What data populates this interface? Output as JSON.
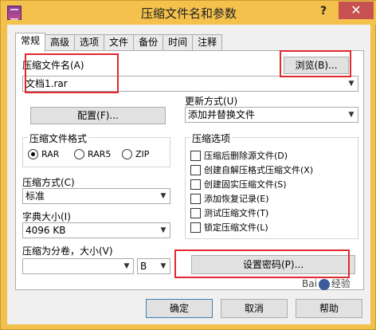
{
  "window": {
    "title": "压缩文件名和参数",
    "help": "?",
    "close": "✕"
  },
  "tabs": [
    "常规",
    "高级",
    "选项",
    "文件",
    "备份",
    "时间",
    "注释"
  ],
  "archive": {
    "label": "压缩文件名(A)",
    "value": "文档1.rar",
    "browse_label": "浏览(B)..."
  },
  "update": {
    "label": "更新方式(U)",
    "value": "添加并替换文件"
  },
  "profile_label": "配置(F)...",
  "format": {
    "title": "压缩文件格式",
    "options": [
      "RAR",
      "RAR5",
      "ZIP"
    ],
    "selected": "RAR"
  },
  "options_group": {
    "title": "压缩选项",
    "items": [
      "压缩后删除源文件(D)",
      "创建自解压格式压缩文件(X)",
      "创建固实压缩文件(S)",
      "添加恢复记录(E)",
      "测试压缩文件(T)",
      "锁定压缩文件(L)"
    ]
  },
  "method": {
    "label": "压缩方式(C)",
    "value": "标准"
  },
  "dictionary": {
    "label": "字典大小(I)",
    "value": "4096 KB"
  },
  "split": {
    "label": "压缩为分卷，大小(V)",
    "value": "",
    "unit": "B"
  },
  "password_label": "设置密码(P)...",
  "buttons": {
    "ok": "确定",
    "cancel": "取消",
    "help": "帮助"
  },
  "watermark": {
    "brand_left": "Bai",
    "brand_right": "经验"
  },
  "colors": {
    "highlight_box": "#e0282f",
    "titlebar": "#f4c14c",
    "close": "#c75050"
  },
  "icons": [
    "winrar-app-icon",
    "radio-icon",
    "checkbox-icon",
    "dropdown-arrow-icon"
  ]
}
